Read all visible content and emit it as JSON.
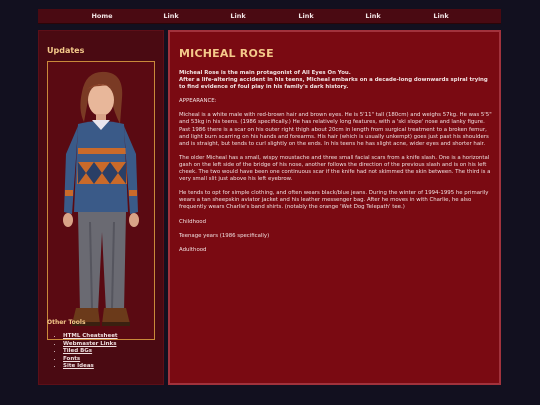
{
  "nav": {
    "items": [
      "Home",
      "Link",
      "Link",
      "Link",
      "Link",
      "Link"
    ]
  },
  "sidebar": {
    "heading": "Updates",
    "portrait_icon": "character-portrait",
    "other_heading": "Other Tools",
    "tools": [
      "HTML Cheatsheet",
      "Webmaster Links",
      "Tiled BGs",
      "Fonts",
      "Site Ideas"
    ]
  },
  "main": {
    "title": "MICHEAL ROSE",
    "intro_line1": "Micheal Rose is the main protagonist of All Eyes On You.",
    "intro_line2": "After a life-altering accident in his teens, Micheal embarks on a decade-long downwards spiral trying to find evidence of foul play in his family's dark history.",
    "appearance_heading": "APPEARANCE:",
    "para1": "Micheal is a white male with red-brown hair and brown eyes. He is 5'11\" tall (180cm) and weighs 57kg. He was 5'5\" and 53kg in his teens. (1986 specifically.) He has relatively long features, with a 'ski slope' nose and lanky figure. Past 1986 there is a scar on his outer right thigh about 20cm in length from surgical treatment to a broken femur, and light burn scarring on his hands and forearms. His hair (which is usually unkempt) goes just past his shoulders and is straight, but tends to curl slightly on the ends. In his teens he has slight acne, wider eyes and shorter hair.",
    "para2": "The older Micheal has a small, wispy moustache and three small facial scars from a knife slash. One is a horizontal gash on the left side of the bridge of his nose, another follows the direction of the previous slash and is on his left cheek. The two would have been one continuous scar if the knife had not skimmed the skin between. The third is a very small slit just above his left eyebrow.",
    "para3": "He tends to opt for simple clothing, and often wears black/blue jeans. During the winter of 1994-1995 he primarily wears a tan sheepskin aviator jacket and his leather messenger bag. After he moves in with Charlie, he also frequently wears Charlie's band shirts. (notably the orange 'Wet Dog Telepath' tee.)",
    "section1": "Childhood",
    "section2": "Teenage years (1986 specifically)",
    "section3": "Adulthood"
  },
  "colors": {
    "page_bg": "#12101f",
    "panel_bg": "#4a0a12",
    "main_bg": "#7a0a12",
    "accent": "#f4c98a"
  }
}
